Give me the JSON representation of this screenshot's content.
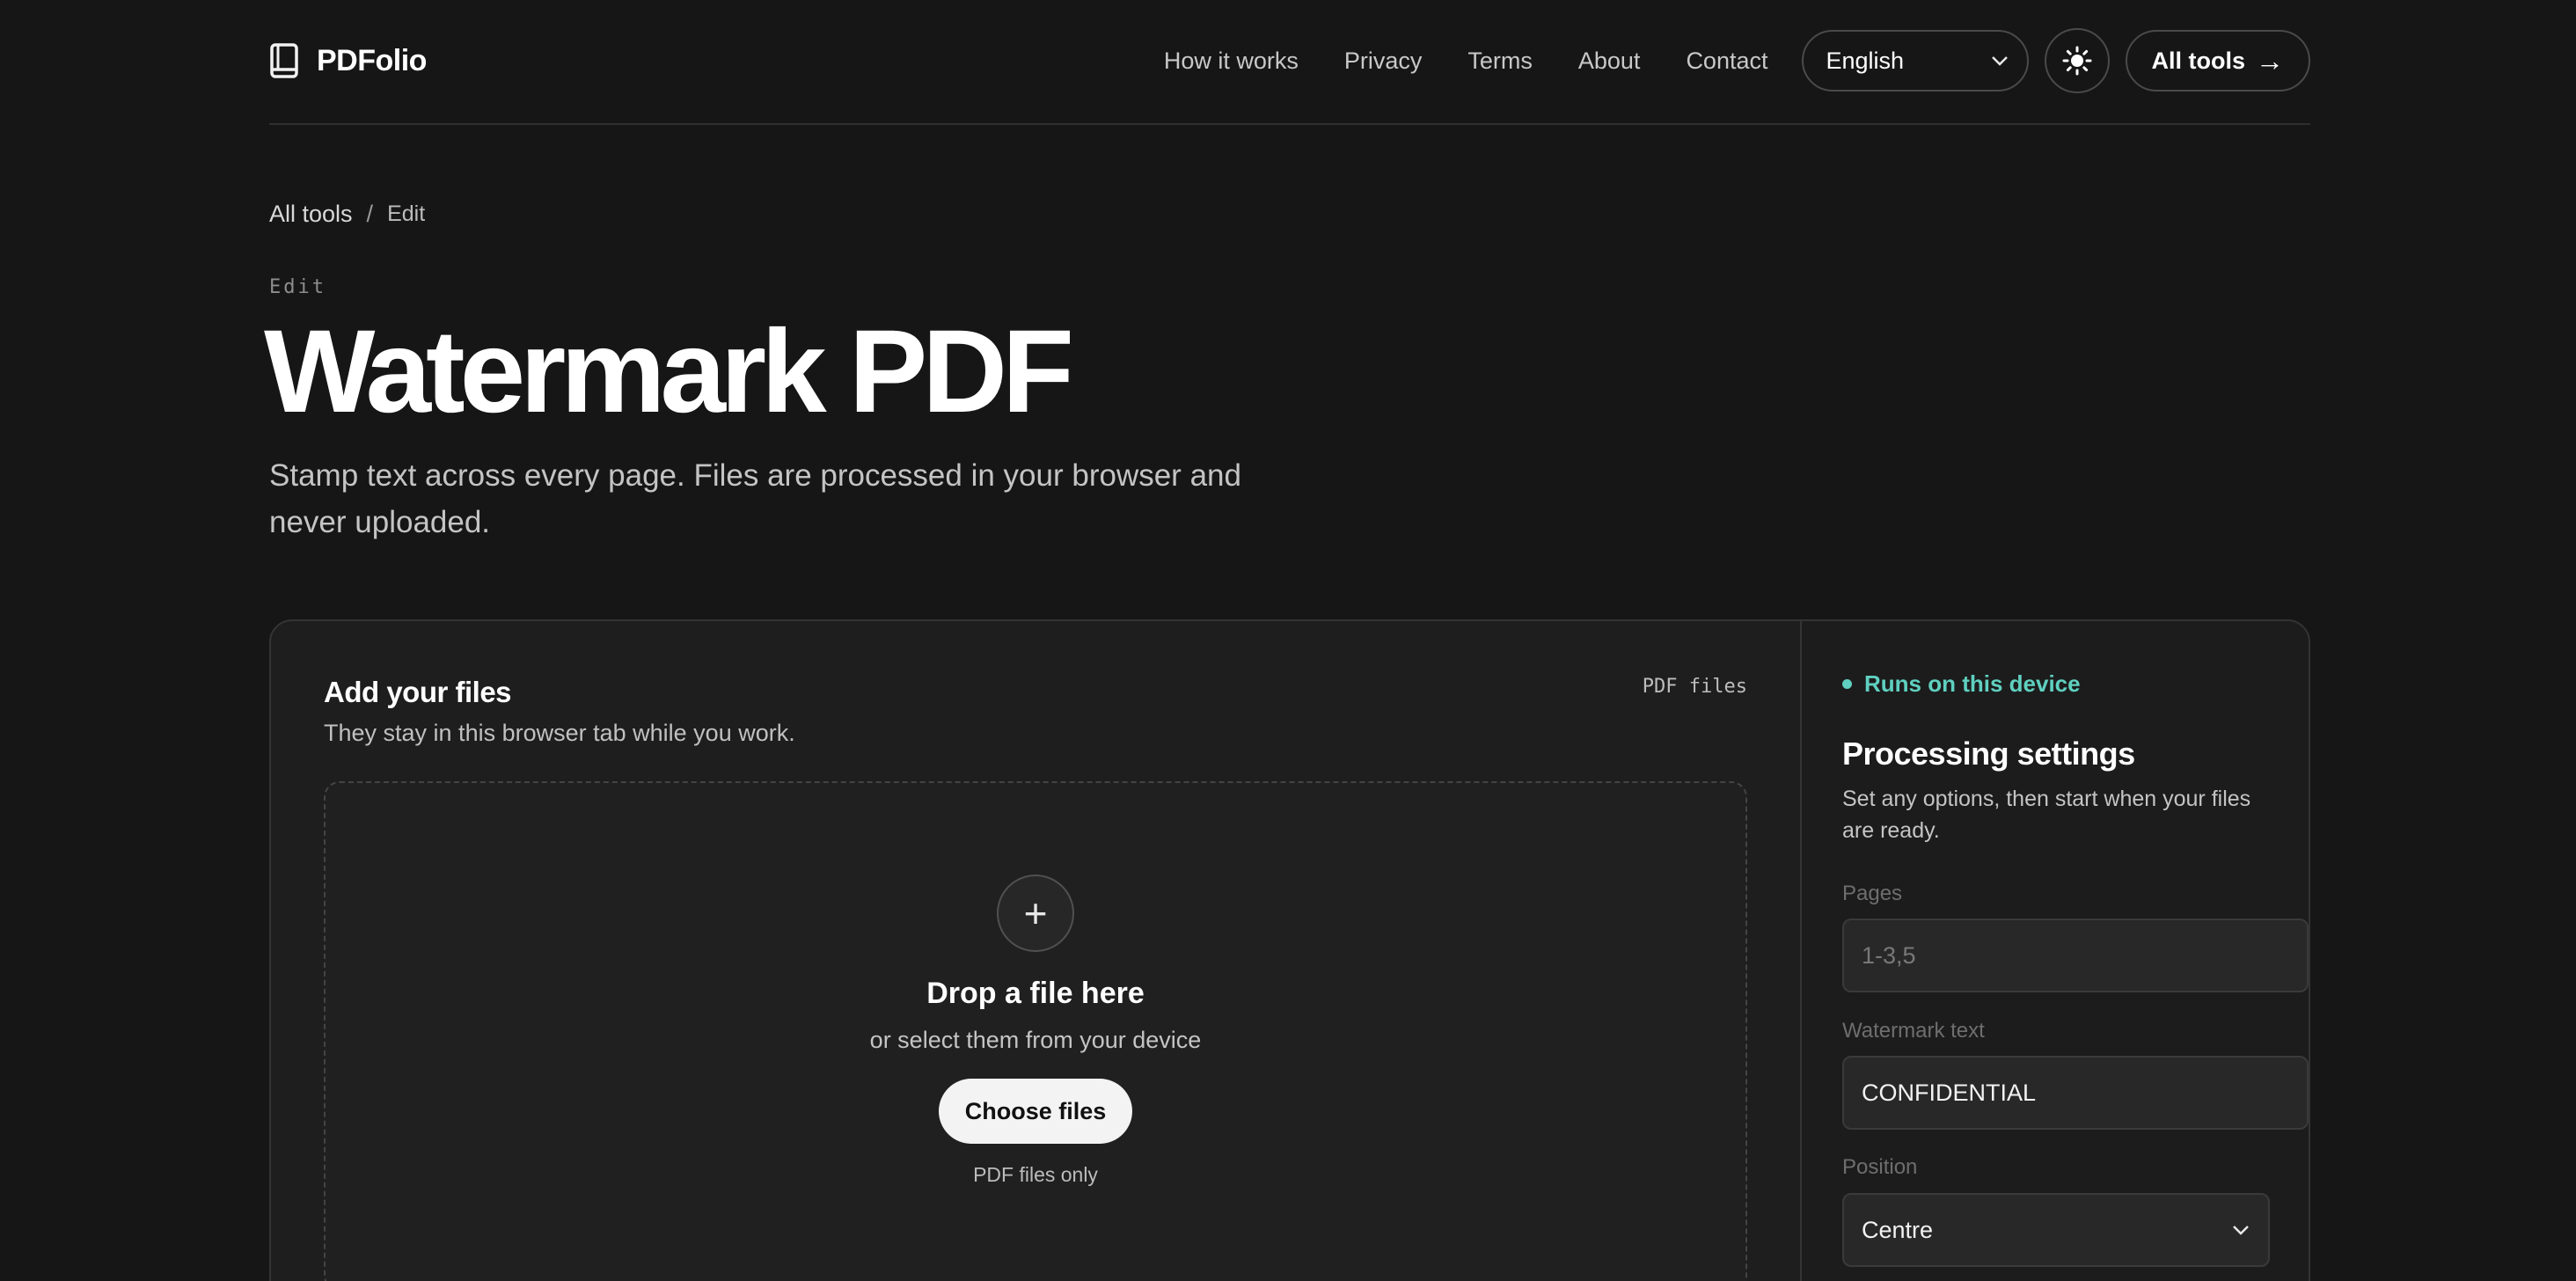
{
  "header": {
    "brand": "PDFolio",
    "nav": [
      "How it works",
      "Privacy",
      "Terms",
      "About",
      "Contact"
    ],
    "language": "English",
    "all_tools_label": "All tools",
    "all_tools_arrow": "→"
  },
  "breadcrumb": {
    "root": "All tools",
    "separator": "/",
    "current": "Edit"
  },
  "hero": {
    "eyebrow": "Edit",
    "title": "Watermark PDF",
    "subtitle": "Stamp text across every page. Files are processed in your browser and never uploaded."
  },
  "upload": {
    "title": "Add your files",
    "subtitle": "They stay in this browser tab while you work.",
    "file_tag": "PDF files",
    "plus": "+",
    "drop_title": "Drop a file here",
    "drop_sub": "or select them from your device",
    "choose_label": "Choose files",
    "note": "PDF files only"
  },
  "settings": {
    "status": "Runs on this device",
    "title": "Processing settings",
    "description": "Set any options, then start when your files are ready.",
    "pages_label": "Pages",
    "pages_placeholder": "1-3,5",
    "watermark_label": "Watermark text",
    "watermark_value": "CONFIDENTIAL",
    "position_label": "Position",
    "position_value": "Centre"
  },
  "colors": {
    "background": "#161616",
    "card": "#1e1e1e",
    "accent": "#5fd0c0",
    "button": "#f3f3f3"
  },
  "icons": {
    "brand": "book-icon",
    "theme": "sun-icon",
    "select": "chevron-down-icon"
  }
}
